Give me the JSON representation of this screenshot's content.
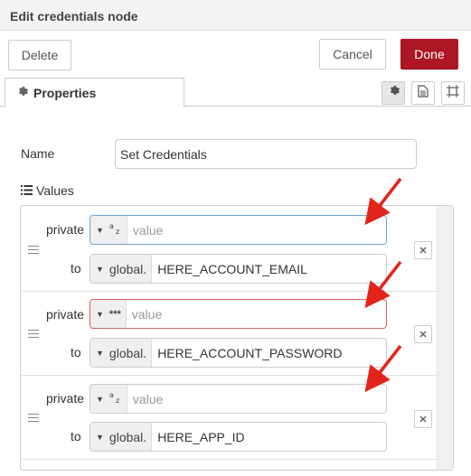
{
  "dialog": {
    "title": "Edit credentials node"
  },
  "toolbar": {
    "delete_label": "Delete",
    "cancel_label": "Cancel",
    "done_label": "Done"
  },
  "tabs": {
    "properties_label": "Properties",
    "properties_icon": "gear-icon"
  },
  "tools": [
    "gear-icon",
    "document-icon",
    "frame-icon"
  ],
  "form": {
    "name_label": "Name",
    "name_value": "Set Credentials",
    "values_label": "Values",
    "values_icon": "list-icon"
  },
  "rows": [
    {
      "private_label": "private",
      "to_label": "to",
      "private_type_icon": "az-icon",
      "private_placeholder": "value",
      "to_prefix": "global.",
      "to_value": "HERE_ACCOUNT_EMAIL"
    },
    {
      "private_label": "private",
      "to_label": "to",
      "private_type_icon": "asterisk-icon",
      "private_type_text": "***",
      "private_placeholder": "value",
      "to_prefix": "global.",
      "to_value": "HERE_ACCOUNT_PASSWORD"
    },
    {
      "private_label": "private",
      "to_label": "to",
      "private_type_icon": "az-icon",
      "private_placeholder": "value",
      "to_prefix": "global.",
      "to_value": "HERE_APP_ID"
    }
  ],
  "colors": {
    "primary": "#ad1625",
    "focus": "#6ea3cf",
    "error": "#d6615e",
    "annotation_arrow": "#e3241c"
  }
}
